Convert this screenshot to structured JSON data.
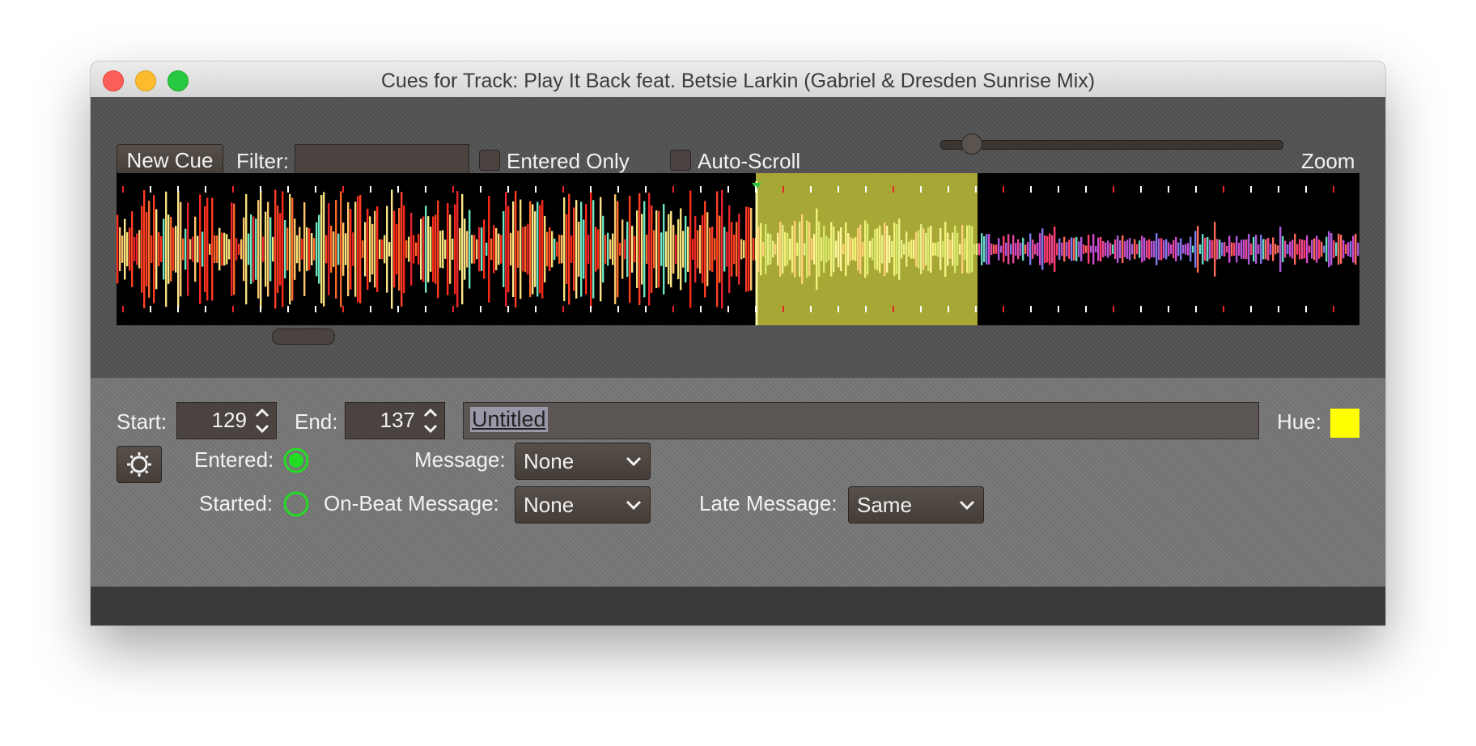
{
  "window": {
    "title": "Cues for Track: Play It Back feat. Betsie Larkin (Gabriel & Dresden Sunrise Mix)"
  },
  "toolbar": {
    "new_cue_label": "New Cue",
    "filter_label": "Filter:",
    "filter_value": "",
    "entered_only_label": "Entered Only",
    "entered_only_checked": false,
    "auto_scroll_label": "Auto-Scroll",
    "auto_scroll_checked": false,
    "zoom_label": "Zoom",
    "zoom_level": 0.08
  },
  "waveform": {
    "selection_color": "#a7a736",
    "background": "#000000"
  },
  "cue": {
    "start_label": "Start:",
    "start_value": "129",
    "end_label": "End:",
    "end_value": "137",
    "name_value": "Untitled",
    "hue_label": "Hue:",
    "hue_color": "#ffff00",
    "entered_label": "Entered:",
    "entered_active": true,
    "started_label": "Started:",
    "started_active": false,
    "message_label": "Message:",
    "message_value": "None",
    "onbeat_label": "On-Beat Message:",
    "onbeat_value": "None",
    "late_label": "Late Message:",
    "late_value": "Same",
    "gear_icon": "gear-icon",
    "indicator_color": "#22dd22"
  }
}
